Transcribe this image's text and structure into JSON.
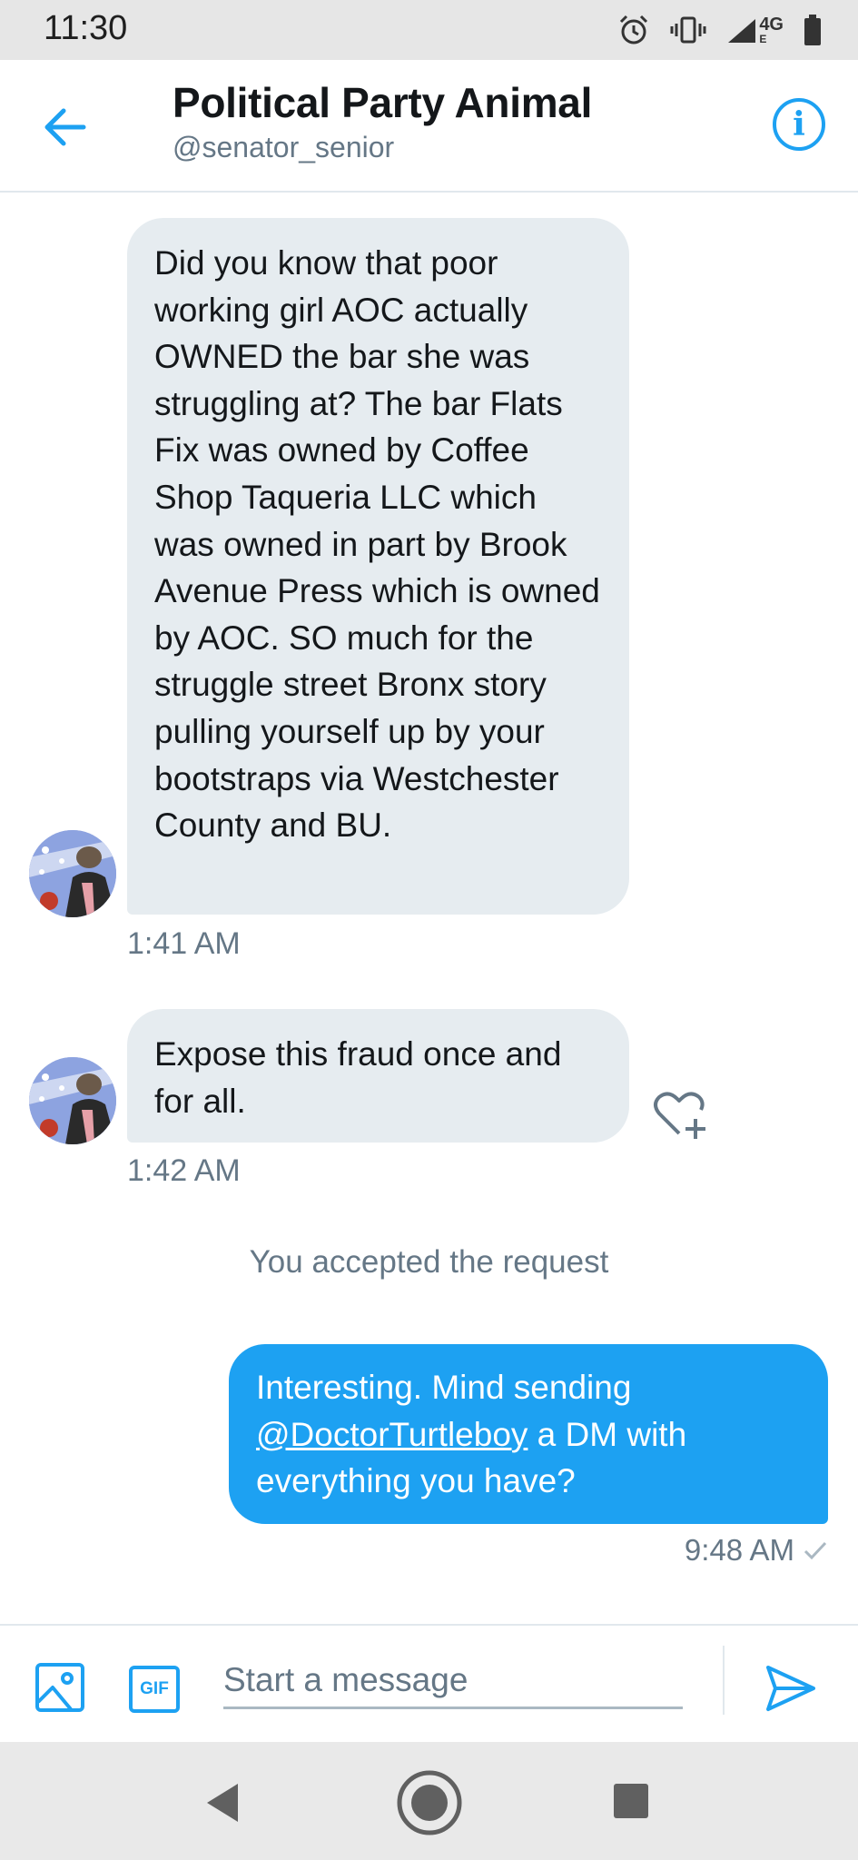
{
  "status_bar": {
    "time": "11:30",
    "network": "4G",
    "network_sub": "E"
  },
  "header": {
    "title": "Political Party Animal",
    "handle": "@senator_senior"
  },
  "messages": [
    {
      "text": "Did you know that poor working girl AOC actually OWNED the bar she was struggling at? The bar Flats Fix was owned by Coffee Shop Taqueria LLC which was owned in part by Brook Avenue Press which is owned by AOC. SO much for the struggle street Bronx story pulling yourself up by your bootstraps via Westchester County and BU.",
      "time": "1:41 AM"
    },
    {
      "text": "Expose this fraud once and for all.",
      "time": "1:42 AM"
    }
  ],
  "system_note": "You accepted the request",
  "outgoing": {
    "text_before": "Interesting. Mind  sending ",
    "mention": "@DoctorTurtleboy",
    "text_after": " a DM with everything you have?",
    "time": "9:48 AM"
  },
  "composer": {
    "placeholder": "Start a message",
    "gif_label": "GIF"
  },
  "colors": {
    "accent": "#1da1f2",
    "incoming_bubble": "#e6ecf0",
    "secondary_text": "#657786"
  }
}
